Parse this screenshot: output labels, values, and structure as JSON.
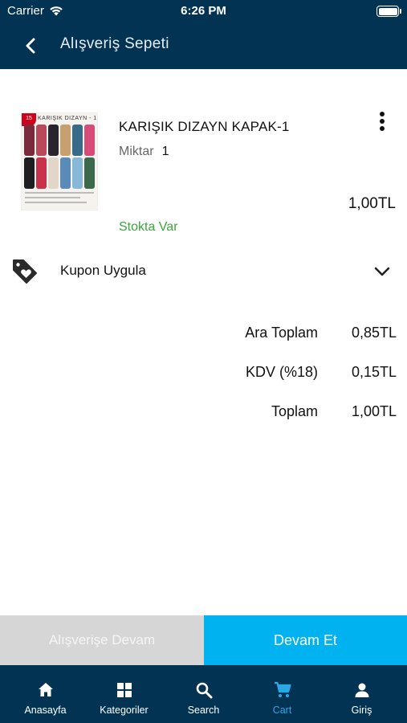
{
  "status_bar": {
    "carrier": "Carrier",
    "time": "6:26 PM"
  },
  "header": {
    "title": "Alışveriş Sepeti"
  },
  "cart_item": {
    "name": "KARIŞIK DIZAYN KAPAK-1",
    "quantity_label": "Miktar",
    "quantity": "1",
    "price": "1,00TL",
    "stock_status": "Stokta Var",
    "thumbnail_caption": "KARIŞIK DIZAYN - 1",
    "thumbnail_badge": "15"
  },
  "coupon": {
    "label": "Kupon Uygula"
  },
  "totals": {
    "subtotal_label": "Ara Toplam",
    "subtotal_value": "0,85TL",
    "tax_label": "KDV (%18)",
    "tax_value": "0,15TL",
    "total_label": "Toplam",
    "total_value": "1,00TL"
  },
  "actions": {
    "continue_shopping": "Alışverişe Devam",
    "proceed": "Devam Et"
  },
  "tabbar": {
    "active": "Cart",
    "items": [
      {
        "label": "Anasayfa",
        "icon": "home-icon"
      },
      {
        "label": "Kategoriler",
        "icon": "grid-icon"
      },
      {
        "label": "Search",
        "icon": "search-icon"
      },
      {
        "label": "Cart",
        "icon": "cart-icon"
      },
      {
        "label": "Giriş",
        "icon": "user-icon"
      }
    ]
  },
  "colors": {
    "header_bg": "#023352",
    "accent": "#00b2f0",
    "active_tab": "#2aa8e6",
    "stock_green": "#3aa63a",
    "disabled_button": "#d6d6d6"
  }
}
